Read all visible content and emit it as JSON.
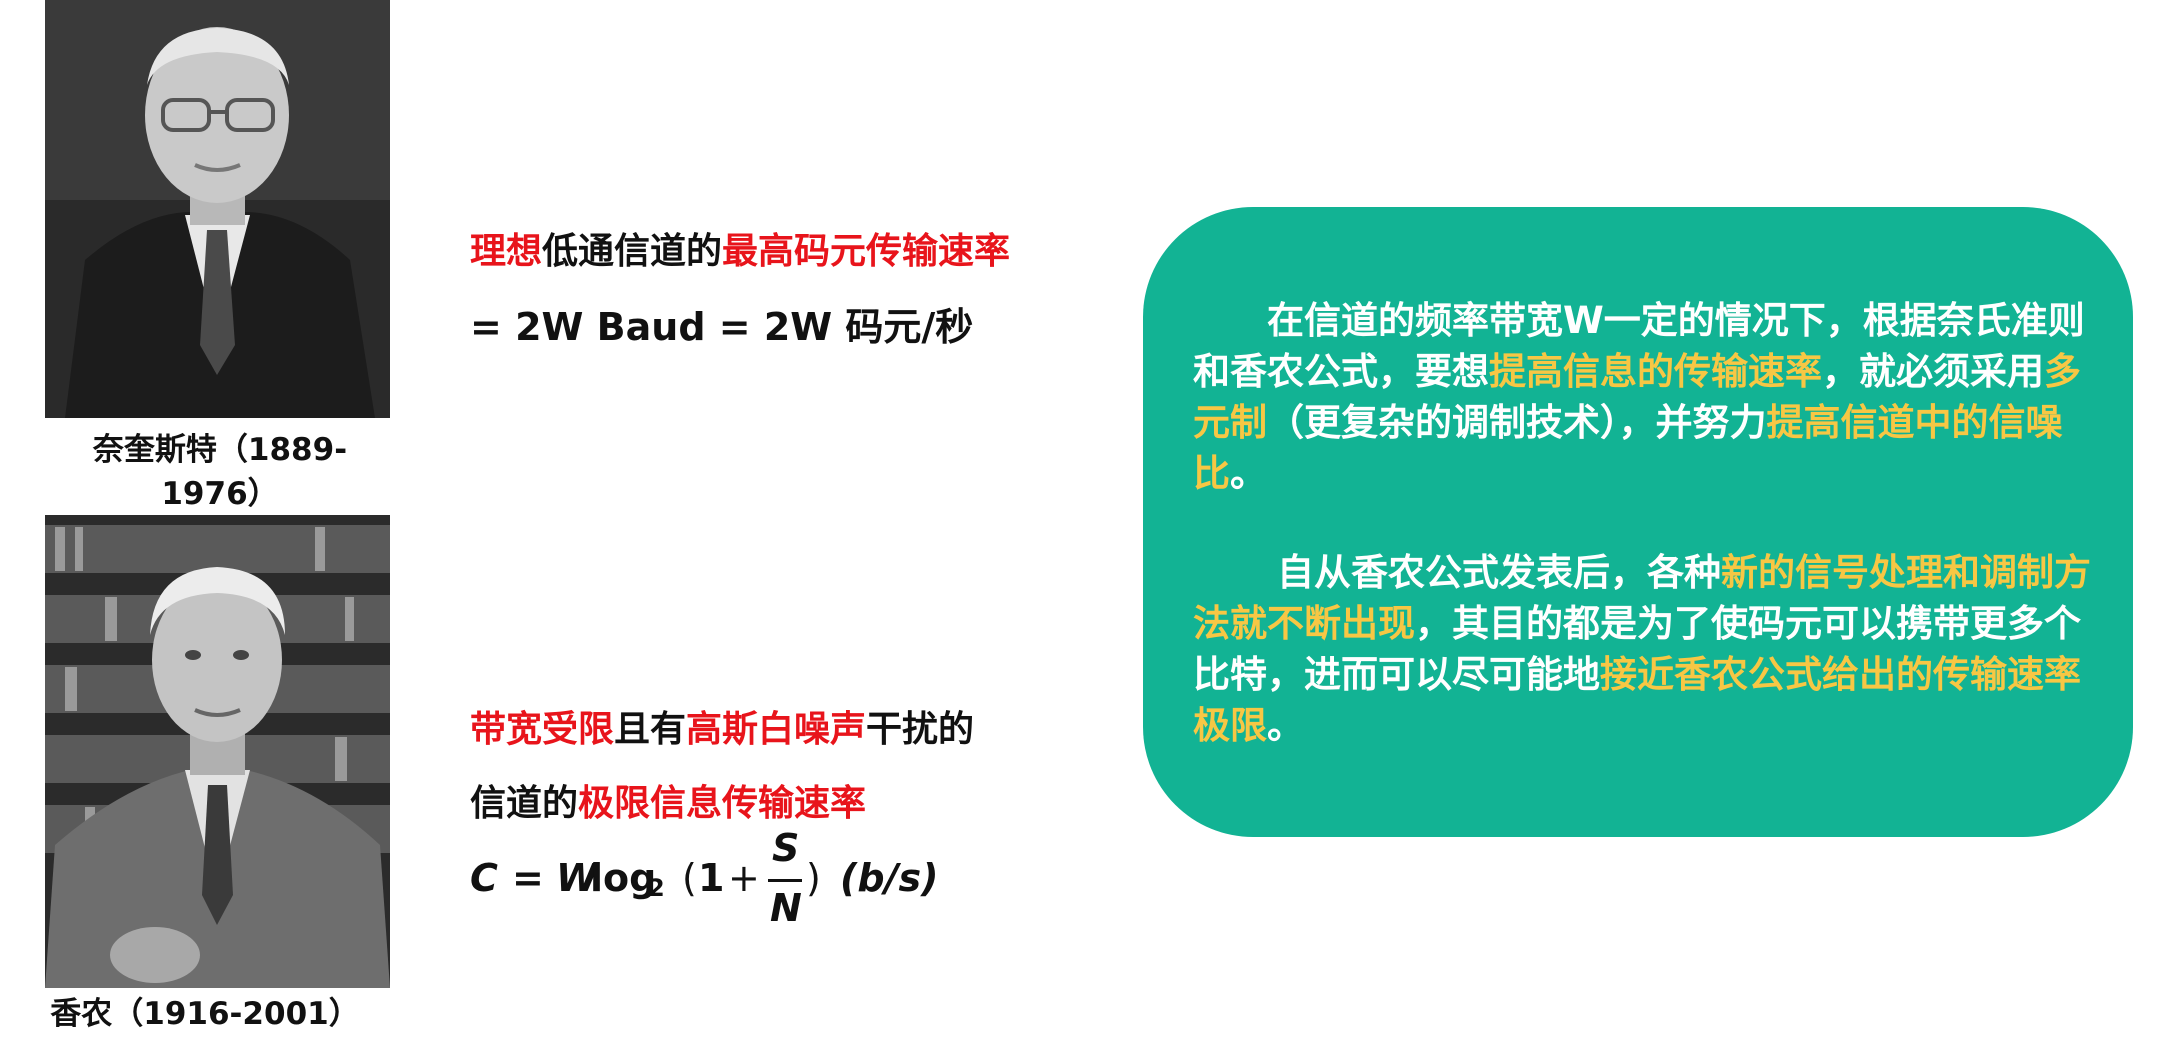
{
  "portraits": {
    "nyquist_caption": "奈奎斯特（1889-1976）",
    "shannon_caption": "香农（1916-2001）"
  },
  "nyquist_rate": {
    "line1": [
      {
        "text": "理想",
        "color": "red"
      },
      {
        "text": "低通信道的",
        "color": "black"
      },
      {
        "text": "最高码元传输速率",
        "color": "red"
      }
    ],
    "line2": "= 2W Baud = 2W 码元/秒"
  },
  "shannon_limit": {
    "line1": [
      {
        "text": "带宽受限",
        "color": "red"
      },
      {
        "text": "且有",
        "color": "black"
      },
      {
        "text": "高斯白噪声",
        "color": "red"
      },
      {
        "text": "干扰的",
        "color": "black"
      }
    ],
    "line2": [
      {
        "text": "信道的",
        "color": "black"
      },
      {
        "text": "极限信息传输速率",
        "color": "red"
      }
    ],
    "formula": {
      "lhs": "C",
      "equals": "=",
      "w": "W",
      "log": "log",
      "base": "2",
      "open": "(",
      "one": "1",
      "plus": "+",
      "num": "S",
      "den": "N",
      "close": ")",
      "unit": "(b/s)"
    }
  },
  "info_box": {
    "para1": [
      {
        "text": "在信道的频率带宽W一定的情况下，根据奈氏准则和香农公式，要想",
        "hl": false
      },
      {
        "text": "提高信息的传输速率",
        "hl": true
      },
      {
        "text": "，就必须采用",
        "hl": false
      },
      {
        "text": "多元制",
        "hl": true
      },
      {
        "text": "（更复杂的调制技术），并努力",
        "hl": false
      },
      {
        "text": "提高信道中的信噪比",
        "hl": true
      },
      {
        "text": "。",
        "hl": false
      }
    ],
    "para2": [
      {
        "text": "自从香农公式发表后，各种",
        "hl": false
      },
      {
        "text": "新的信号处理和调制方法就不断出现",
        "hl": true
      },
      {
        "text": "，其目的都是为了使码元可以携带更多个比特，进而可以尽可能地",
        "hl": false
      },
      {
        "text": "接近香农公式给出的传输速率极限",
        "hl": true
      },
      {
        "text": "。",
        "hl": false
      }
    ],
    "colors": {
      "background": "#12b394",
      "text": "#ffffff",
      "highlight": "#f7c744"
    }
  },
  "colors": {
    "red": "#e8141b",
    "black": "#111111"
  }
}
